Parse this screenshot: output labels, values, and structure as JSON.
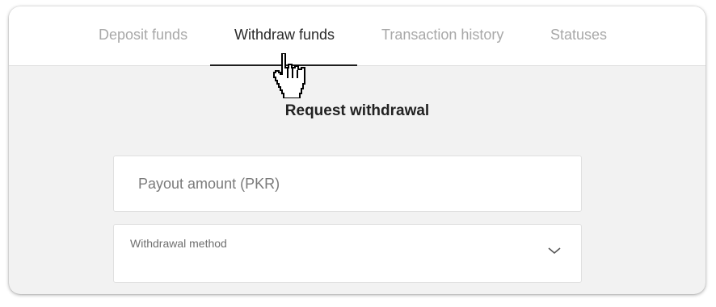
{
  "tabs": [
    {
      "label": "Deposit funds",
      "active": false
    },
    {
      "label": "Withdraw funds",
      "active": true
    },
    {
      "label": "Transaction history",
      "active": false
    },
    {
      "label": "Statuses",
      "active": false
    }
  ],
  "main": {
    "title": "Request withdrawal",
    "amount_field": {
      "placeholder": "Payout amount (PKR)",
      "value": ""
    },
    "method_field": {
      "label": "Withdrawal method",
      "selected_value": "",
      "icon": "chevron-down-icon"
    }
  },
  "cursor": {
    "icon": "hand-pointer-icon"
  },
  "colors": {
    "active_tab_text": "#2a2a2a",
    "inactive_tab_text": "#a8a8a8",
    "content_background": "#f2f2f2",
    "underline": "#1e1e1e"
  }
}
